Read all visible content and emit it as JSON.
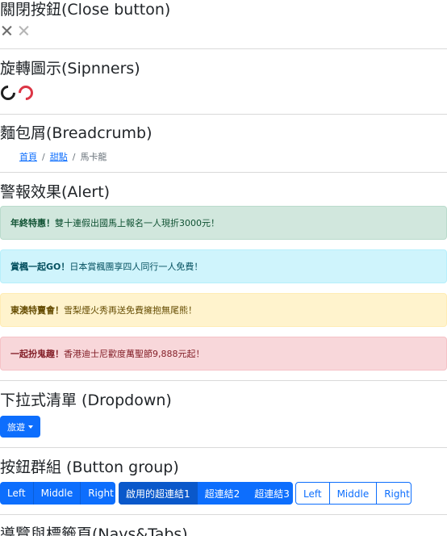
{
  "close_section": {
    "heading": "關閉按鈕(Close button)",
    "icons": [
      "close-icon",
      "close-icon-disabled"
    ]
  },
  "spinner_section": {
    "heading": "旋轉圖示(Sipnners)",
    "colors": [
      "#1f1f1f",
      "#dc3545"
    ]
  },
  "breadcrumb_section": {
    "heading": "麵包屑(Breadcrumb)",
    "items": [
      "首頁",
      "甜點",
      "馬卡龍"
    ],
    "separator": "/"
  },
  "alert_section": {
    "heading": "警報效果(Alert)",
    "alerts": [
      {
        "strong": "年終特惠！",
        "text": "雙十連假出國馬上報名一人現折3000元！"
      },
      {
        "strong": "賞楓一起GO！",
        "text": "日本賞楓團享四人同行一人免費！"
      },
      {
        "strong": "東澳特賣會！",
        "text": "雪梨煙火秀再送免費擁抱無尾熊！"
      },
      {
        "strong": "一起扮鬼趣！",
        "text": "香港迪士尼歡度萬聖節9,888元起！"
      }
    ]
  },
  "dropdown_section": {
    "heading": "下拉式清單 (Dropdown)",
    "button_label": "旅遊"
  },
  "button_group_section": {
    "heading": "按鈕群組 (Button group)",
    "group1": [
      "Left",
      "Middle",
      "Right"
    ],
    "group2": [
      "啟用的超連結1",
      "超連結2",
      "超連結3"
    ],
    "group3": [
      "Left",
      "Middle",
      "Right"
    ]
  },
  "navs_section": {
    "heading": "導覽與標籤頁(Navs&Tabs)"
  },
  "colors": {
    "primary": "#0d6efd",
    "danger": "#dc3545"
  }
}
